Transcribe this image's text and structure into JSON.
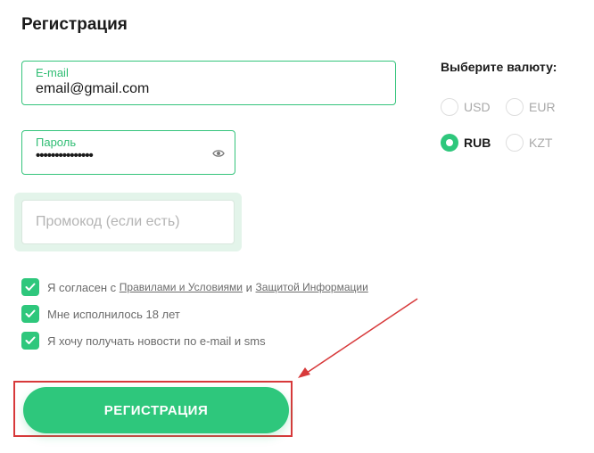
{
  "form": {
    "title": "Регистрация",
    "email": {
      "label": "E-mail",
      "value": "email@gmail.com"
    },
    "password": {
      "label": "Пароль",
      "value": "•••••••••••••••"
    },
    "promo": {
      "placeholder": "Промокод (если есть)"
    },
    "submit_label": "РЕГИСТРАЦИЯ"
  },
  "currency": {
    "title": "Выберите валюту:",
    "options": [
      "USD",
      "EUR",
      "RUB",
      "KZT"
    ],
    "selected": "RUB"
  },
  "agreements": {
    "terms": {
      "prefix": "Я согласен с",
      "rules_link": "Правилами и Условиями",
      "and": "и",
      "privacy_link": "Защитой Информации",
      "checked": true
    },
    "age": {
      "text": "Мне исполнилось 18 лет",
      "checked": true
    },
    "news": {
      "text": "Я хочу получать новости по e-mail и sms",
      "checked": true
    }
  },
  "colors": {
    "accent": "#2ec77c",
    "highlight": "#d7393a"
  },
  "icons": {
    "password_toggle": "eye-icon",
    "checkbox": "check-icon"
  }
}
